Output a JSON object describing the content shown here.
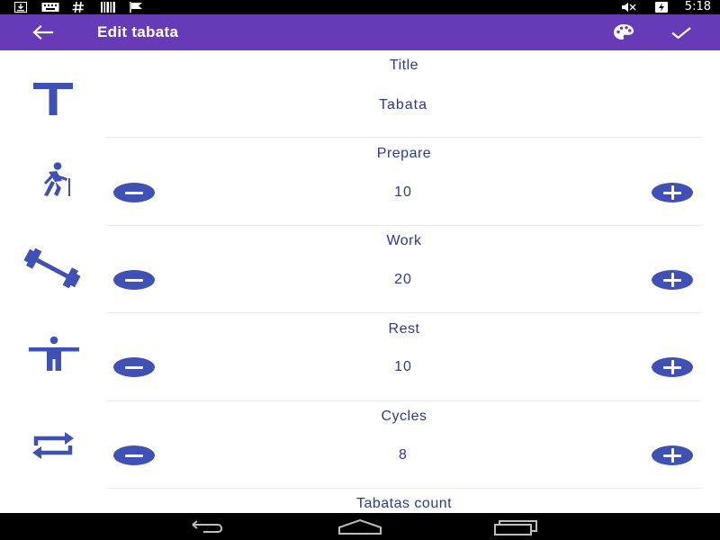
{
  "status_bar": {
    "time": "5:18",
    "icons": [
      "download-icon",
      "keyboard-icon",
      "hash-icon",
      "barcode-icon",
      "flag-icon",
      "mute-icon",
      "battery-charging-icon"
    ]
  },
  "app_bar": {
    "title": "Edit tabata",
    "background": "#673ab7",
    "icons": [
      "back-arrow-icon",
      "palette-icon",
      "checkmark-icon"
    ]
  },
  "accent_color": "#3f51b5",
  "text_color": "#2c3a8f",
  "fields": {
    "title": {
      "label": "Title",
      "value": "Tabata",
      "icon": "title-t-icon"
    },
    "prepare": {
      "label": "Prepare",
      "value": "10",
      "icon": "walking-person-icon"
    },
    "work": {
      "label": "Work",
      "value": "20",
      "icon": "dumbbell-icon"
    },
    "rest": {
      "label": "Rest",
      "value": "10",
      "icon": "standing-person-icon"
    },
    "cycles": {
      "label": "Cycles",
      "value": "8",
      "icon": "repeat-icon"
    },
    "tabatas_count": {
      "label": "Tabatas count"
    }
  },
  "nav_bar": {
    "buttons": [
      "back-nav-icon",
      "home-nav-icon",
      "recents-nav-icon"
    ]
  }
}
